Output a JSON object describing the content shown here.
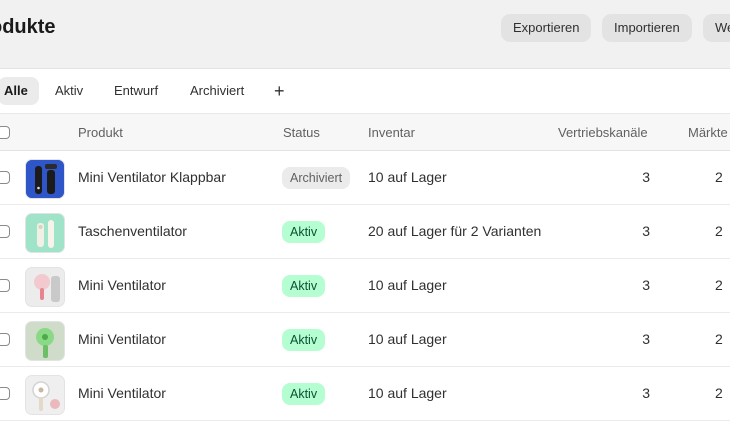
{
  "header": {
    "title": "odukte",
    "buttons": [
      "Exportieren",
      "Importieren",
      "We"
    ]
  },
  "tabs": [
    {
      "label": "Alle",
      "selected": true
    },
    {
      "label": "Aktiv"
    },
    {
      "label": "Entwurf"
    },
    {
      "label": "Archiviert"
    }
  ],
  "tab_add_label": "+",
  "table": {
    "columns": [
      "Produkt",
      "Status",
      "Inventar",
      "Vertriebskanäle",
      "Märkte"
    ],
    "rows": [
      {
        "product": "Mini Ventilator Klappbar",
        "status": "Archiviert",
        "status_type": "archived",
        "inventory": "10 auf Lager",
        "channels": "3",
        "markets": "2",
        "thumb_icon": "black-foldable-fan"
      },
      {
        "product": "Taschenventilator",
        "status": "Aktiv",
        "status_type": "active",
        "inventory": "20 auf Lager für 2 Varianten",
        "channels": "3",
        "markets": "2",
        "thumb_icon": "green-pocket-fan"
      },
      {
        "product": "Mini Ventilator",
        "status": "Aktiv",
        "status_type": "active",
        "inventory": "10 auf Lager",
        "channels": "3",
        "markets": "2",
        "thumb_icon": "pink-handheld-fan"
      },
      {
        "product": "Mini Ventilator",
        "status": "Aktiv",
        "status_type": "active",
        "inventory": "10 auf Lager",
        "channels": "3",
        "markets": "2",
        "thumb_icon": "green-handheld-fan"
      },
      {
        "product": "Mini Ventilator",
        "status": "Aktiv",
        "status_type": "active",
        "inventory": "10 auf Lager",
        "channels": "3",
        "markets": "2",
        "thumb_icon": "white-handheld-fan"
      }
    ]
  },
  "colors": {
    "active_badge_bg": "#b4fed2",
    "active_badge_text": "#0c5132",
    "archived_badge_bg": "#ebebeb",
    "header_bg": "#f1f1f1"
  }
}
